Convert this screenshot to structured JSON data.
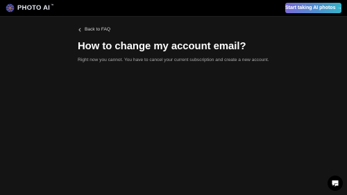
{
  "header": {
    "logo_text": "PHOTO AI",
    "logo_tm": "™",
    "cta_label": "Start taking AI photos →"
  },
  "nav": {
    "back_label": "Back to FAQ"
  },
  "article": {
    "title": "How to change my account email?",
    "body": "Right now you cannot. You have to cancel your current subscription and create a new account."
  },
  "icons": {
    "logo": "photo-ai-logo-icon",
    "back": "chevron-left-icon",
    "chat": "chat-bubble-icon"
  },
  "colors": {
    "background": "#141414",
    "header": "#000000",
    "cta_gradient": [
      "#7a6bd6",
      "#34b3c9"
    ]
  }
}
